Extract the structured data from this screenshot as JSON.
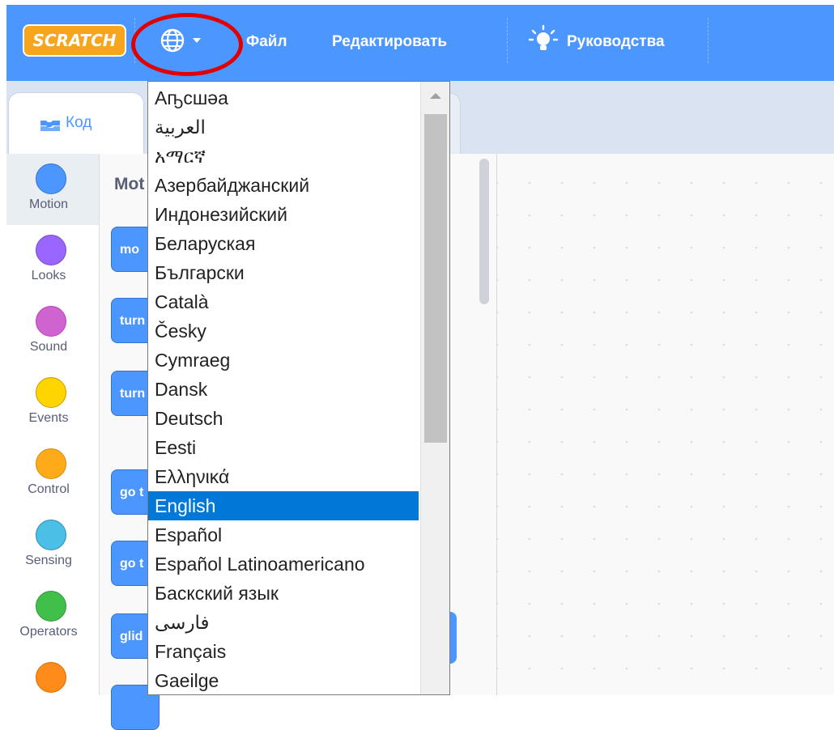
{
  "menubar": {
    "logo_text": "SCRATCH",
    "file_label": "Файл",
    "edit_label": "Редактировать",
    "tutorials_label": "Руководства",
    "colors": {
      "bar": "#4c97ff",
      "highlight_ring": "#e00000",
      "logo": "#f7a51d"
    }
  },
  "tabs": {
    "code_label": "Код"
  },
  "categories": [
    {
      "label": "Motion",
      "color": "#4c97ff",
      "border": "#3373cc"
    },
    {
      "label": "Looks",
      "color": "#9966ff",
      "border": "#774dcb"
    },
    {
      "label": "Sound",
      "color": "#cf63cf",
      "border": "#bd42bd"
    },
    {
      "label": "Events",
      "color": "#ffd500",
      "border": "#cc9900"
    },
    {
      "label": "Control",
      "color": "#ffab19",
      "border": "#cf8b17"
    },
    {
      "label": "Sensing",
      "color": "#4cbfe6",
      "border": "#2e8eb8"
    },
    {
      "label": "Operators",
      "color": "#40bf4a",
      "border": "#389438"
    },
    {
      "label": "",
      "color": "#ff8c1a",
      "border": "#db6e00"
    }
  ],
  "palette": {
    "heading": "Mot",
    "blocks": [
      "mo",
      "turn",
      "turn",
      "go t",
      "go t",
      "glid"
    ]
  },
  "language_dropdown": {
    "selected": "English",
    "items": [
      "Аҧсшәа",
      "العربية",
      "አማርኛ",
      "Азербайджанский",
      "Индонезийский",
      "Беларуская",
      "Български",
      "Català",
      "Česky",
      "Cymraeg",
      "Dansk",
      "Deutsch",
      "Eesti",
      "Ελληνικά",
      "English",
      "Español",
      "Español Latinoamericano",
      "Баскский язык",
      "فارسی",
      "Français",
      "Gaeilge"
    ]
  }
}
